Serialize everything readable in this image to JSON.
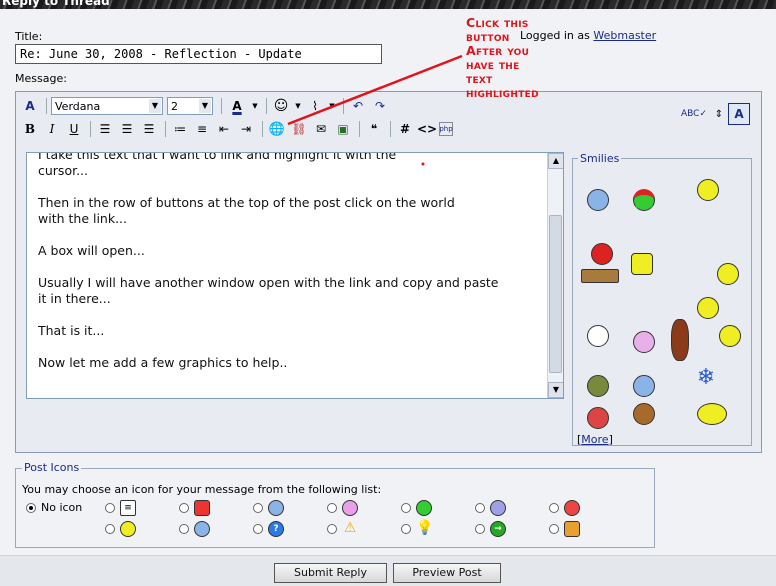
{
  "window": {
    "title": "Reply to Thread"
  },
  "form": {
    "title_label": "Title:",
    "title_value": "Re: June 30, 2008 - Reflection - Update",
    "message_label": "Message:",
    "logged_prefix": "Logged in as",
    "logged_user": "Webmaster"
  },
  "toolbar": {
    "font_name": "Verdana",
    "font_size": "2"
  },
  "message": {
    "text": "I take this text that I want to link and highlight it with the\ncursor...\n\nThen in the row of buttons at the top of the post click on the world\nwith the link...\n\nA box will open...\n\nUsually I will have another window open with the link and copy and paste\nit in there...\n\nThat is it...\n\nNow let me add a few graphics to help.."
  },
  "smilies": {
    "legend": "Smilies",
    "more_label": "More",
    "bracket_open": "[",
    "bracket_close": "]"
  },
  "post_icons": {
    "legend": "Post Icons",
    "description": "You may choose an icon for your message from the following list:",
    "no_icon_label": "No icon"
  },
  "buttons": {
    "submit": "Submit Reply",
    "preview": "Preview Post"
  },
  "annotation": {
    "line1": "Click this",
    "line2": "button",
    "line3": "After you",
    "line4": "have the",
    "line5": "text",
    "line6": "highlighted"
  },
  "colors": {
    "accent_blue": "#1a2b8a",
    "annotation_red": "#e0141a",
    "panel_bg": "#e8ecf2"
  }
}
